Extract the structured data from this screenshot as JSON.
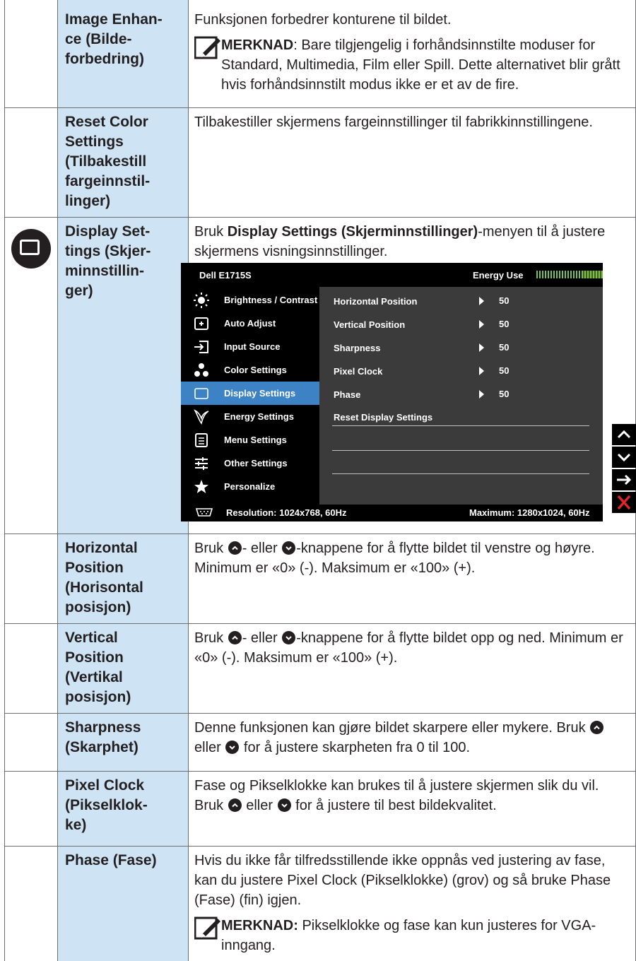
{
  "rows": [
    {
      "name": "Image Enhan-\nce (Bilde-\nforbedring)",
      "desc": "Funksjonen forbedrer konturene til bildet.",
      "note_label": "MERKNAD",
      "note_text": ": Bare tilgjengelig i forhåndsinnstilte moduser for Standard, Multimedia, Film eller Spill. Dette alternativet blir grått hvis forhåndsinnstilt modus ikke er et av de fire."
    },
    {
      "name": "Reset Color\nSettings\n(Tilbakestill\nfargeinnstil-\nlinger)",
      "desc": "Tilbakestiller skjermens fargeinnstillinger til fabrikkinnstillingene."
    },
    {
      "name": "Display Set-\ntings (Skjer-\nminnstillin-\nger)",
      "desc_pre": "Bruk ",
      "desc_bold": "Display Settings (Skjerminnstillinger)",
      "desc_post": "-menyen til å justere skjermens visningsinnstillinger."
    },
    {
      "name": "Horizontal\nPosition\n(Horisontal\nposisjon)",
      "desc_a": "Bruk ",
      "desc_b": "- eller ",
      "desc_c": "-knappene for å flytte bildet til venstre og høyre. Minimum er «0» (-). Maksimum er «100» (+)."
    },
    {
      "name": "Vertical\nPosition\n(Vertikal\nposisjon)",
      "desc_a": "Bruk ",
      "desc_b": "- eller ",
      "desc_c": "-knappene for å flytte bildet opp og ned. Minimum er «0» (-). Maksimum er «100» (+)."
    },
    {
      "name": "Sharpness\n(Skarphet)",
      "desc_a": "Denne funksjonen kan gjøre bildet skarpere eller mykere. Bruk ",
      "desc_b": " eller ",
      "desc_c": " for å justere skarpheten fra 0 til 100."
    },
    {
      "name": "Pixel Clock\n(Pikselklok-\nke)",
      "desc_a": "Fase og Pikselklokke kan brukes til å justere skjermen slik du vil. Bruk ",
      "desc_b": " eller ",
      "desc_c": " for å justere til best bildekvalitet."
    },
    {
      "name": "Phase (Fase)",
      "desc": "Hvis du ikke får tilfredsstillende ikke oppnås ved justering av fase, kan du justere Pixel Clock (Pikselklokke) (grov) og så bruke Phase (Fase) (fin) igjen.",
      "note_label": "MERKNAD:",
      "note_text": " Pikselklokke og fase kan kun justeres for VGA-inngang."
    }
  ],
  "osd": {
    "model": "Dell E1715S",
    "energy_label": "Energy Use",
    "menu": [
      {
        "label": "Brightness / Contrast",
        "icon": "brightness-icon"
      },
      {
        "label": "Auto Adjust",
        "icon": "auto-adjust-icon"
      },
      {
        "label": "Input Source",
        "icon": "input-source-icon"
      },
      {
        "label": "Color Settings",
        "icon": "color-settings-icon"
      },
      {
        "label": "Display Settings",
        "icon": "display-settings-icon",
        "selected": true
      },
      {
        "label": "Energy Settings",
        "icon": "energy-settings-icon"
      },
      {
        "label": "Menu Settings",
        "icon": "menu-settings-icon"
      },
      {
        "label": "Other Settings",
        "icon": "other-settings-icon"
      },
      {
        "label": "Personalize",
        "icon": "star-icon"
      }
    ],
    "submenu": [
      {
        "label": "Horizontal Position",
        "value": "50"
      },
      {
        "label": "Vertical Position",
        "value": "50"
      },
      {
        "label": "Sharpness",
        "value": "50"
      },
      {
        "label": "Pixel Clock",
        "value": "50"
      },
      {
        "label": "Phase",
        "value": "50"
      },
      {
        "label": "Reset Display Settings"
      }
    ],
    "resolution": "Resolution: 1024x768, 60Hz",
    "maximum": "Maximum: 1280x1024, 60Hz"
  },
  "side_buttons": [
    "up-icon",
    "down-icon",
    "enter-icon",
    "exit-icon"
  ],
  "colors": {
    "name_cell_bg": "#cee3f3",
    "osd_selected": "#3c82c4",
    "osd_panel": "#3b3b3b",
    "exit_red": "#e32526"
  }
}
